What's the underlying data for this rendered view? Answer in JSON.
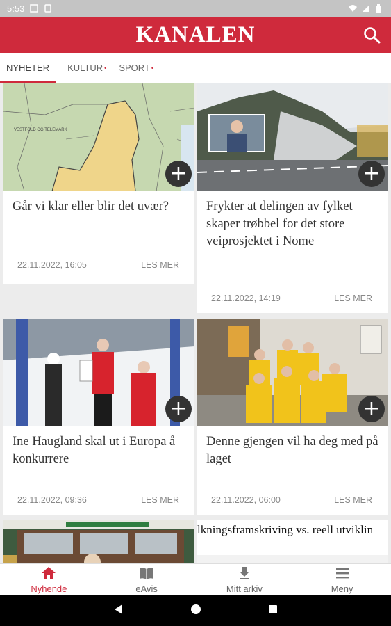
{
  "status_bar": {
    "time": "5:53"
  },
  "app": {
    "logo": "KANALEN",
    "accent": "#cf2a3c"
  },
  "tabs": [
    {
      "label": "NYHETER",
      "active": true
    },
    {
      "label": "KULTUR",
      "dot": "•"
    },
    {
      "label": "SPORT",
      "dot": "•"
    }
  ],
  "articles": [
    {
      "title": "Går vi klar eller blir det uvær?",
      "date": "22.11.2022, 16:05",
      "more": "LES MER",
      "image": "map"
    },
    {
      "title": "Frykter at delingen av fylket skaper trøbbel for det store veiprosjektet i Nome",
      "date": "22.11.2022, 14:19",
      "more": "LES MER",
      "image": "road"
    },
    {
      "title": "Ine Haugland skal ut i Europa å konkurrere",
      "date": "22.11.2022, 09:36",
      "more": "LES MER",
      "image": "ski"
    },
    {
      "title": "Denne gjengen vil ha deg med på laget",
      "date": "22.11.2022, 06:00",
      "more": "LES MER",
      "image": "team"
    },
    {
      "image": "shop"
    },
    {
      "headline_snippet": "lkningsframskriving vs. reell utviklin"
    }
  ],
  "map_label": "VESTFOLD OG TELEMARK",
  "bottom_nav": [
    {
      "label": "Nyhende",
      "icon": "home-icon",
      "active": true
    },
    {
      "label": "eAvis",
      "icon": "book-icon"
    },
    {
      "label": "Mitt arkiv",
      "icon": "download-icon"
    },
    {
      "label": "Meny",
      "icon": "menu-icon"
    }
  ]
}
